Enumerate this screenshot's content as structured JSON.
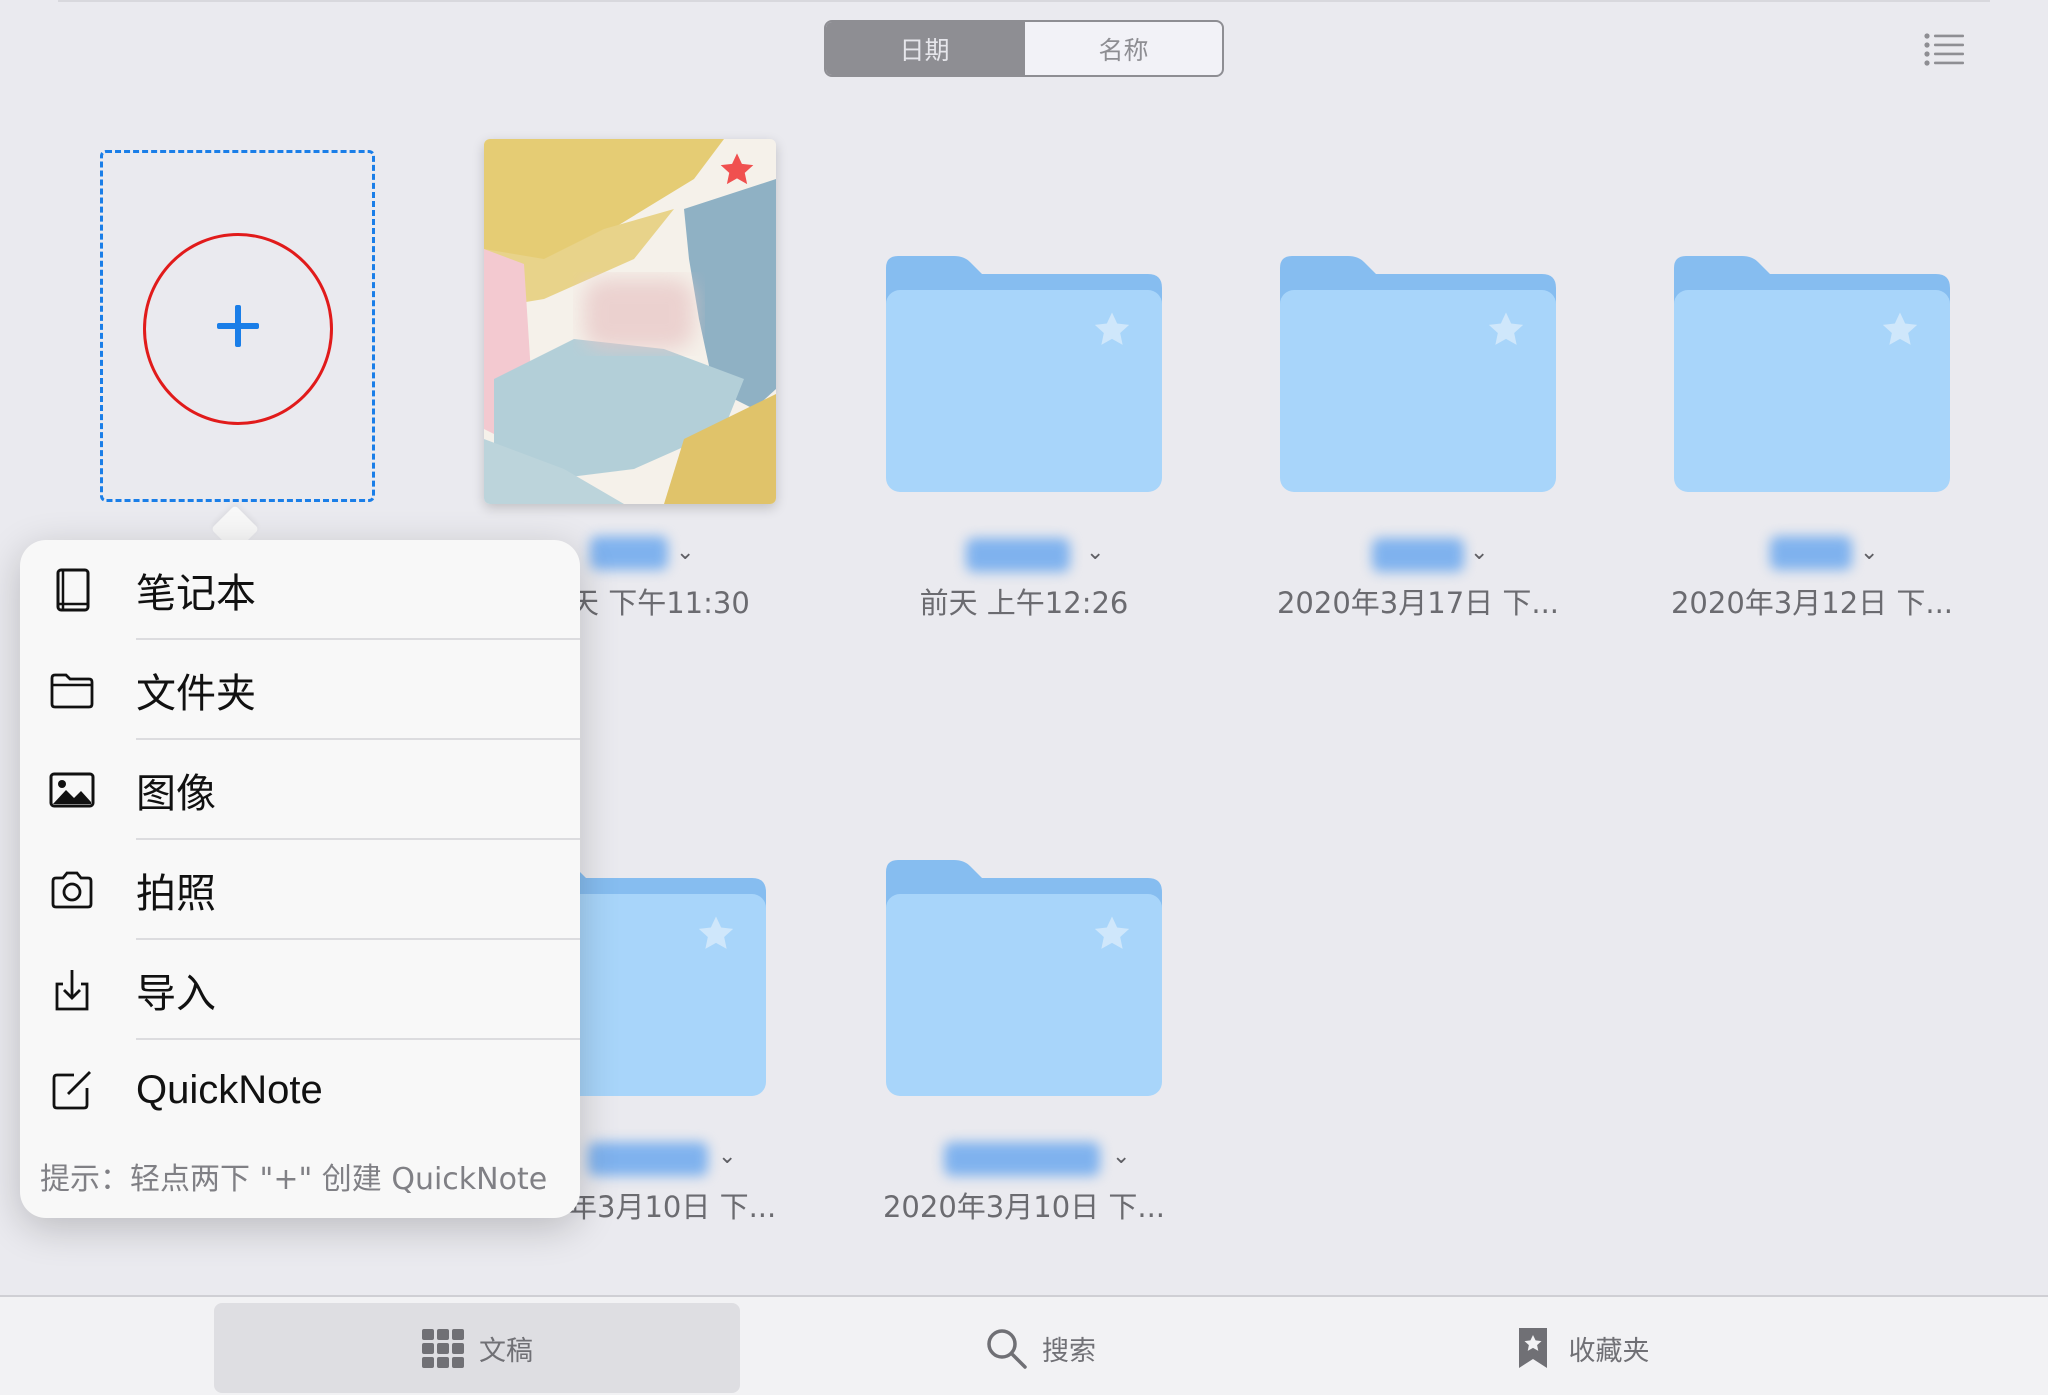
{
  "sort_control": {
    "options": [
      "日期",
      "名称"
    ],
    "selected": "日期"
  },
  "new_item": {
    "plus_label": "+"
  },
  "documents": [
    {
      "type": "notebook",
      "name": "",
      "date": "天 下午11:30",
      "starred": true
    },
    {
      "type": "folder",
      "name": "",
      "date": "前天 上午12:26",
      "starred": false
    },
    {
      "type": "folder",
      "name": "",
      "date": "2020年3月17日 下...",
      "starred": false
    },
    {
      "type": "folder",
      "name": "",
      "date": "2020年3月12日 下...",
      "starred": false
    },
    {
      "type": "folder",
      "name": "",
      "date": "年3月10日 下...",
      "starred": false
    },
    {
      "type": "folder",
      "name": "",
      "date": "2020年3月10日 下...",
      "starred": false
    }
  ],
  "create_menu": {
    "items": [
      {
        "label": "笔记本",
        "icon": "notebook-icon"
      },
      {
        "label": "文件夹",
        "icon": "folder-icon"
      },
      {
        "label": "图像",
        "icon": "image-icon"
      },
      {
        "label": "拍照",
        "icon": "camera-icon"
      },
      {
        "label": "导入",
        "icon": "import-icon"
      },
      {
        "label": "QuickNote",
        "icon": "quicknote-icon"
      }
    ],
    "hint": "提示：轻点两下 \"+\" 创建 QuickNote"
  },
  "tab_bar": {
    "tabs": [
      {
        "label": "文稿",
        "icon": "grid-icon",
        "active": true
      },
      {
        "label": "搜索",
        "icon": "search-icon",
        "active": false
      },
      {
        "label": "收藏夹",
        "icon": "bookmark-star-icon",
        "active": false
      }
    ]
  },
  "colors": {
    "accent": "#1a7ee8",
    "highlight_circle": "#e11b1b",
    "folder_front": "#a8d5fa",
    "folder_back": "#86bdf0",
    "favorite_star": "#f0504f"
  }
}
